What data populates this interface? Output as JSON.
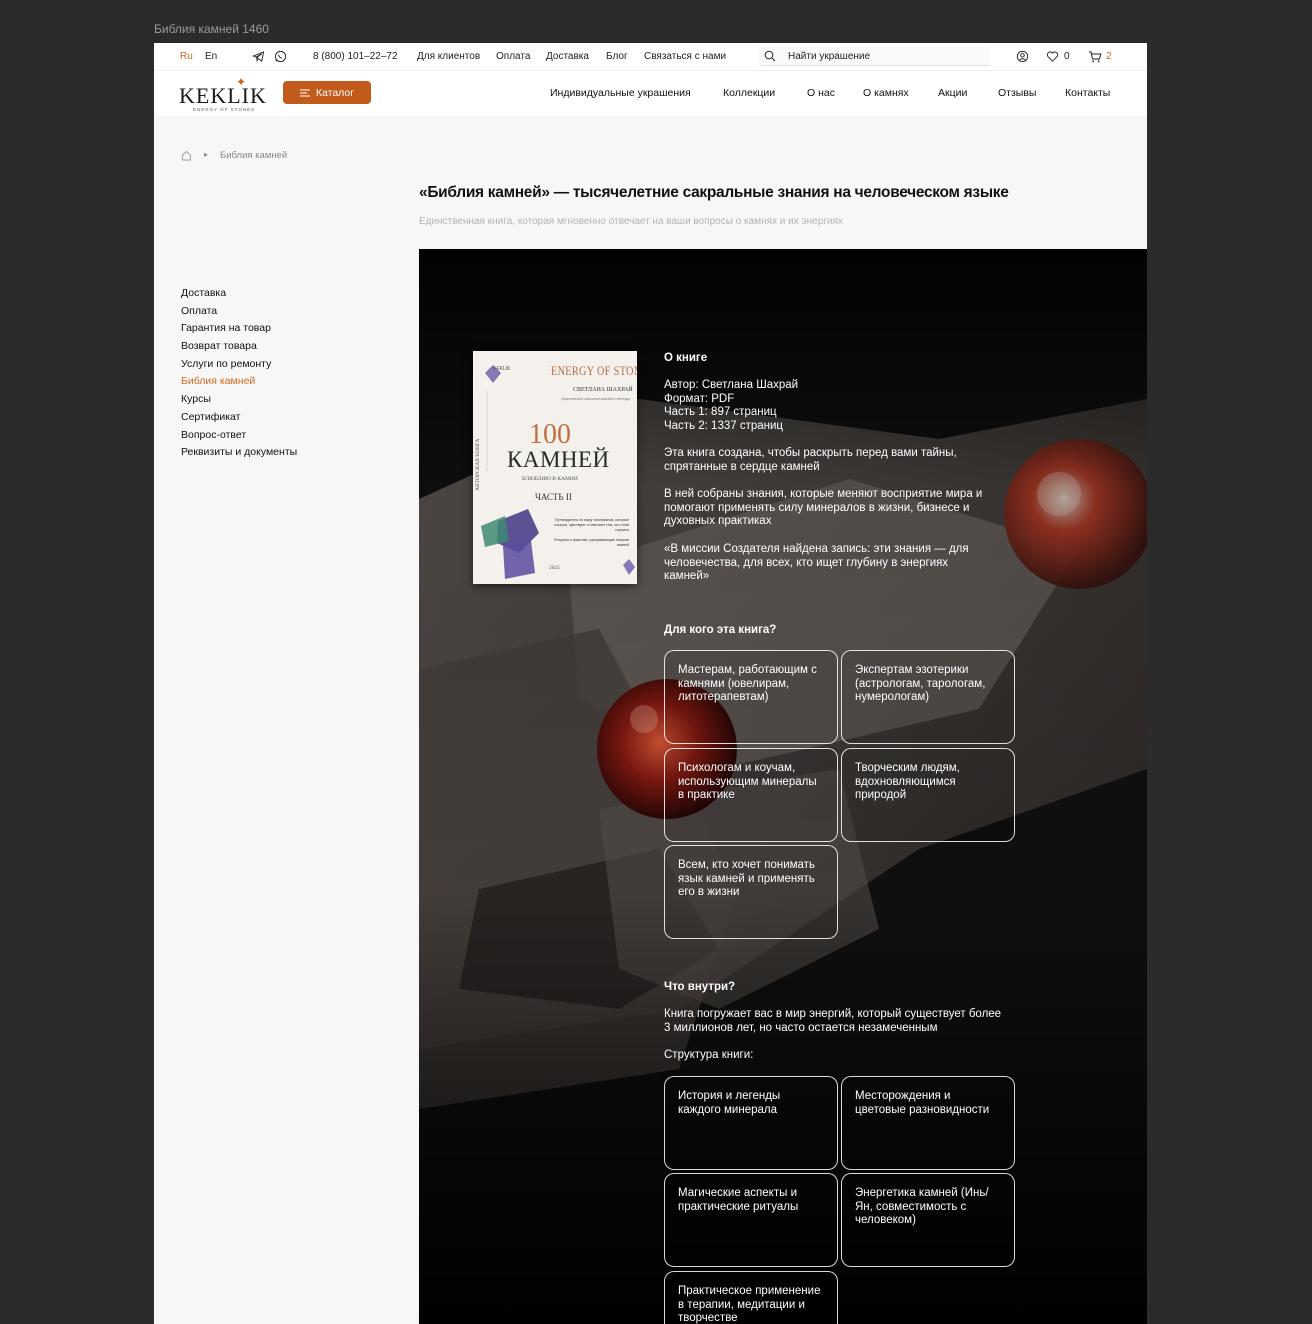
{
  "frame_label": "Библия камней 1460",
  "topbar": {
    "lang_ru": "Ru",
    "lang_en": "En",
    "phone": "8 (800) 101–22–72",
    "links": [
      "Для клиентов",
      "Оплата",
      "Доставка",
      "Блог",
      "Связаться с нами"
    ],
    "search_placeholder": "Найти украшение",
    "favorites_count": "0",
    "cart_count": "2"
  },
  "header": {
    "logo": "KEKLIK",
    "logo_sub": "ENERGY OF STONES",
    "catalog": "Каталог",
    "nav": [
      "Индивидуальные украшения",
      "Коллекции",
      "О нас",
      "О камнях",
      "Акции",
      "Отзывы",
      "Контакты"
    ]
  },
  "breadcrumb": {
    "current": "Библия камней"
  },
  "page": {
    "title": "«Библия камней» — тысячелетние сакральные знания на человеческом языке",
    "subtitle": "Единственная книга, которая мгновенно отвечает на ваши вопросы о камнях и их энергиях"
  },
  "sidebar": {
    "items": [
      "Доставка",
      "Оплата",
      "Гарантия на товар",
      "Возврат товара",
      "Услуги по ремонту",
      "Библия камней",
      "Курсы",
      "Сертификат",
      "Вопрос-ответ",
      "Реквизиты и документы"
    ],
    "active": "Библия камней"
  },
  "cover": {
    "brand": "KEKLIK",
    "top": "ENERGY OF STONES",
    "author": "СВЕТЛАНА ШАХРАЙ",
    "small": "практическое описание камней и легенды",
    "number": "100",
    "word": "КАМНЕЙ",
    "tagline": "ВЛЮБЛЯЮ В КАМНИ",
    "part": "ЧАСТЬ II",
    "side": "АВТОРСКАЯ КНИГА",
    "desc1": "Путеводитель по миру талисманов, которые слышат, чувствуют и отвечают тем, кто готов слушать",
    "desc2": "Ритуалы и практики, раскрывающие энергии камней",
    "year": "2025"
  },
  "about": {
    "title": "О книге",
    "meta": [
      "Автор: Светлана Шахрай",
      "Формат: PDF",
      "Часть 1: 897 страниц",
      "Часть 2: 1337 страниц"
    ],
    "paragraphs": [
      "Эта книга создана, чтобы раскрыть перед вами тайны, спрятанные в сердце камней",
      "В ней собраны знания, которые меняют восприятие мира и помогают применять силу минералов в жизни, бизнесе и духовных практиках",
      "«В миссии Создателя найдена запись: эти знания — для человечества, для всех, кто ищет глубину в энергиях камней»"
    ]
  },
  "audience": {
    "title": "Для кого эта книга?",
    "cards": [
      "Мастерам, работающим с камнями (ювелирам, литотерапевтам)",
      "Экспертам эзотерики (астрологам, тарологам, нумерологам)",
      "Психологам и коучам, использующим минералы в практике",
      "Творческим людям, вдохновляющимся природой",
      "Всем, кто хочет понимать язык камней и применять его в жизни"
    ]
  },
  "inside": {
    "title": "Что внутри?",
    "intro": "Книга погружает вас в мир энергий, который существует более 3 миллионов лет, но часто остается незамеченным",
    "structure_label": "Структура книги:",
    "cards": [
      "История и легенды каждого минерала",
      "Месторождения и цветовые разновидности",
      "Магические аспекты и практические ритуалы",
      "Энергетика камней (Инь/Ян, совместимость с человеком)",
      "Практическое применение в терапии, медитации и творчестве"
    ]
  },
  "colors": {
    "accent": "#d2691e",
    "button": "#c25a1c",
    "hero_bg": "#0d0d0d"
  }
}
